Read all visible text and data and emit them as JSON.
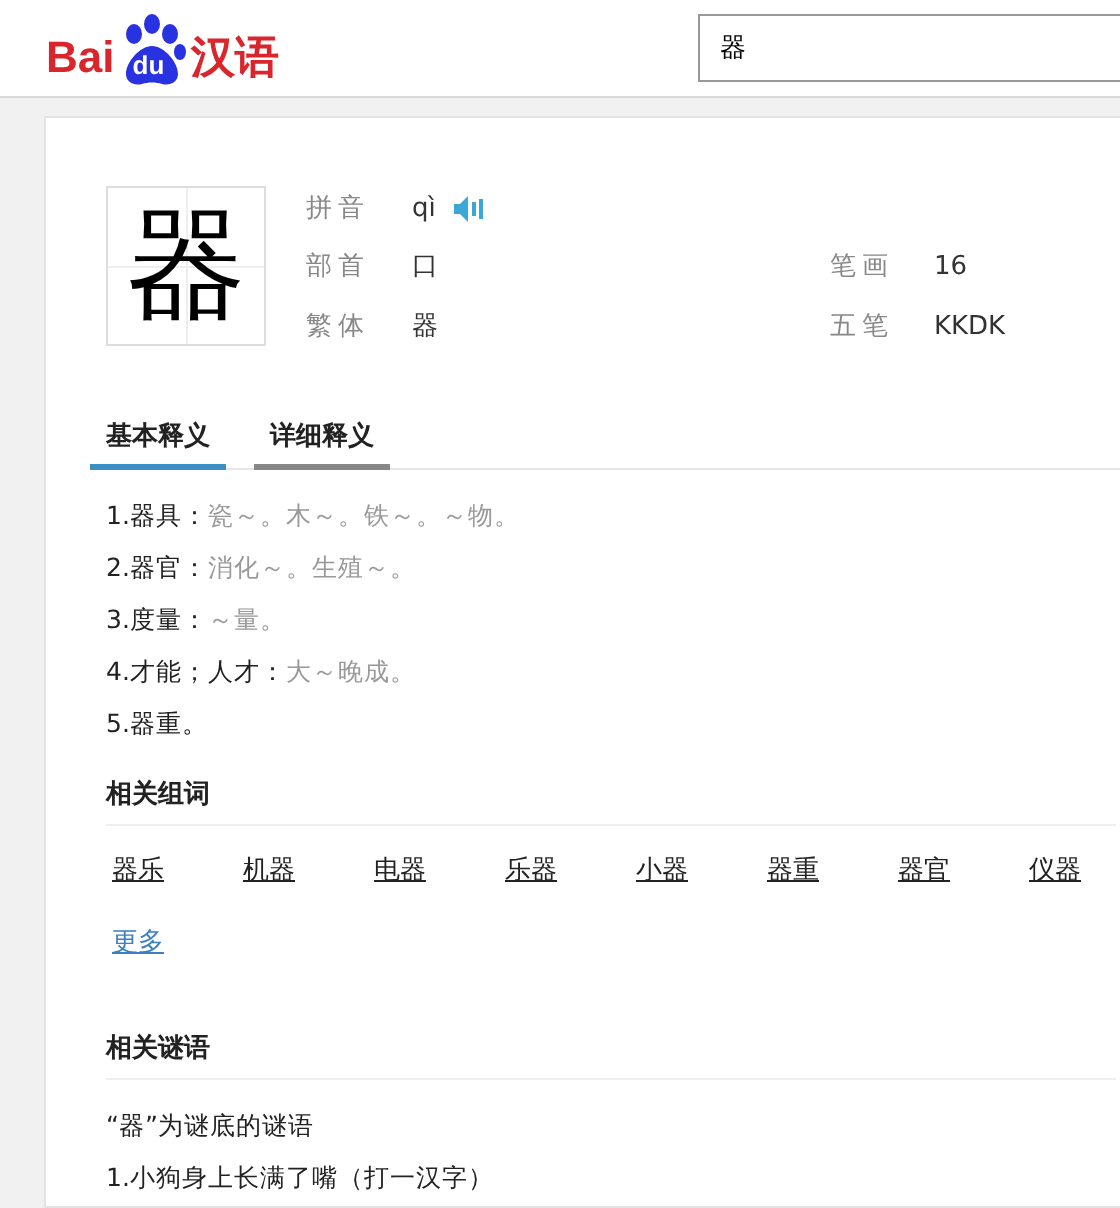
{
  "header": {
    "logo": {
      "prefix": "Bai",
      "paw_text": "du",
      "suffix": "汉语"
    },
    "search": {
      "value": "器"
    }
  },
  "entry": {
    "character": "器",
    "fields": [
      {
        "label": "拼音",
        "value": "qì",
        "kind": "audio"
      },
      {
        "label": "部首",
        "value": "口",
        "kind": "text"
      },
      {
        "label": "笔画",
        "value": "16",
        "kind": "text"
      },
      {
        "label": "繁体",
        "value": "器",
        "kind": "text"
      },
      {
        "label": "五笔",
        "value": "KKDK",
        "kind": "text"
      }
    ]
  },
  "tabs": [
    {
      "label": "基本释义",
      "selected": true
    },
    {
      "label": "详细释义",
      "selected": false
    }
  ],
  "definitions": [
    {
      "term": "1.器具：",
      "example": "瓷～。木～。铁～。～物。"
    },
    {
      "term": "2.器官：",
      "example": "消化～。生殖～。"
    },
    {
      "term": "3.度量：",
      "example": "～量。"
    },
    {
      "term": "4.才能；人才：",
      "example": "大～晚成。"
    },
    {
      "term": "5.器重。"
    }
  ],
  "related_words": {
    "title": "相关组词",
    "words": [
      "器乐",
      "机器",
      "电器",
      "乐器",
      "小器",
      "器重",
      "器官",
      "仪器"
    ],
    "more": "更多"
  },
  "riddles": {
    "title": "相关谜语",
    "intro": "“器”为谜底的谜语",
    "items": [
      "1.小狗身上长满了嘴（打一汉字）"
    ]
  }
}
